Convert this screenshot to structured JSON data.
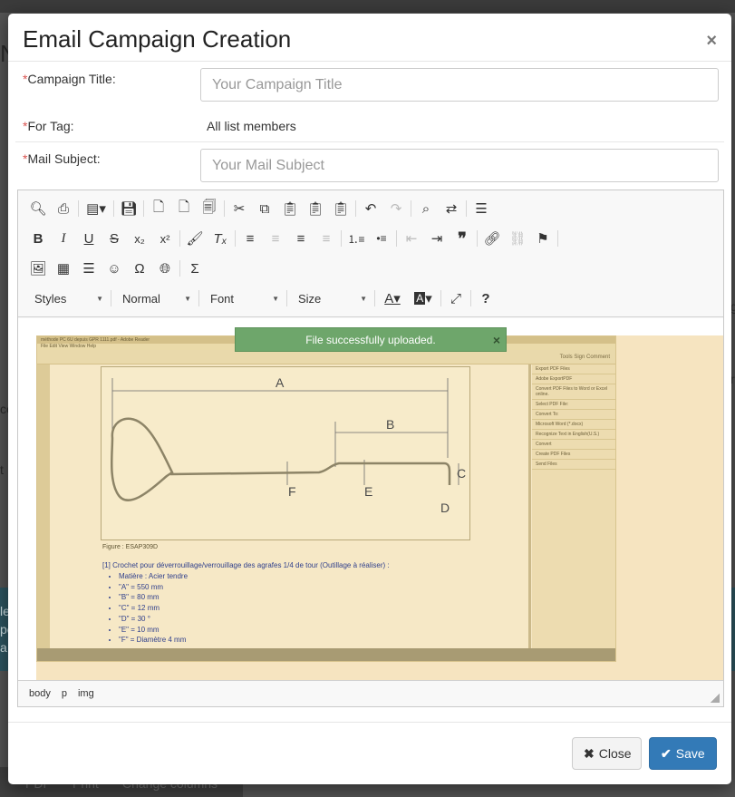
{
  "background": {
    "fragments": [
      "N",
      "ce",
      "t",
      "le",
      "pe",
      "a",
      "c",
      "g",
      "r"
    ],
    "bottom_bar": [
      "PDF",
      "Print",
      "Change columns"
    ]
  },
  "modal": {
    "title": "Email Campaign Creation",
    "close_icon": "×"
  },
  "form": {
    "required_mark": "*",
    "campaign_title": {
      "label": "Campaign Title:",
      "placeholder": "Your Campaign Title",
      "value": ""
    },
    "for_tag": {
      "label": "For Tag:",
      "value": "All list members"
    },
    "mail_subject": {
      "label": "Mail Subject:",
      "placeholder": "Your Mail Subject",
      "value": ""
    }
  },
  "editor": {
    "combos": {
      "styles": "Styles",
      "format": "Normal",
      "font": "Font",
      "size": "Size"
    },
    "toolbar_icons": {
      "preview": "preview-icon",
      "print": "print-icon",
      "templates": "templates-icon",
      "save": "save-icon",
      "new_page": "new-page-icon",
      "document": "document-icon",
      "paste_from_word": "paste-from-word-icon",
      "cut": "cut-icon",
      "copy": "copy-icon",
      "paste": "paste-icon",
      "paste_text": "paste-text-icon",
      "paste_word": "paste-word-icon",
      "undo": "undo-icon",
      "redo": "redo-icon",
      "find": "find-icon",
      "replace": "replace-icon",
      "select_all": "select-all-icon"
    },
    "toast": "File successfully uploaded.",
    "status_path": [
      "body",
      "p",
      "img"
    ],
    "image": {
      "titlebar": "méthode PC 6U depuis GPR 1111.pdf - Adobe Reader",
      "menubar": "File  Edit  View  Window  Help",
      "tools": "Tools   Sign   Comment",
      "figure_caption": "Figure : ESAP309D",
      "heading": "[1] Crochet pour déverrouillage/verrouillage des agrafes 1/4 de tour (Outillage à réaliser) :",
      "list": [
        "Matière : Acier tendre",
        "\"A\" = 550 mm",
        "\"B\" = 80 mm",
        "\"C\" = 12 mm",
        "\"D\" = 30 °",
        "\"E\" = 10 mm",
        "\"F\" = Diamètre 4 mm"
      ],
      "dims": [
        "A",
        "B",
        "C",
        "D",
        "E",
        "F"
      ],
      "panel": [
        "Export PDF Files",
        "Adobe ExportPDF",
        "Convert PDF Files to Word or Excel online.",
        "Select PDF File:",
        "Convert To:",
        "Microsoft Word (*.docx)",
        "Recognize Text in English(U.S.)",
        "Convert",
        "Create PDF Files",
        "Send Files"
      ]
    }
  },
  "footer": {
    "close_label": "Close",
    "save_label": "Save"
  },
  "colors": {
    "primary": "#337ab7",
    "toast": "#6ea66b",
    "required": "#d9534f"
  }
}
